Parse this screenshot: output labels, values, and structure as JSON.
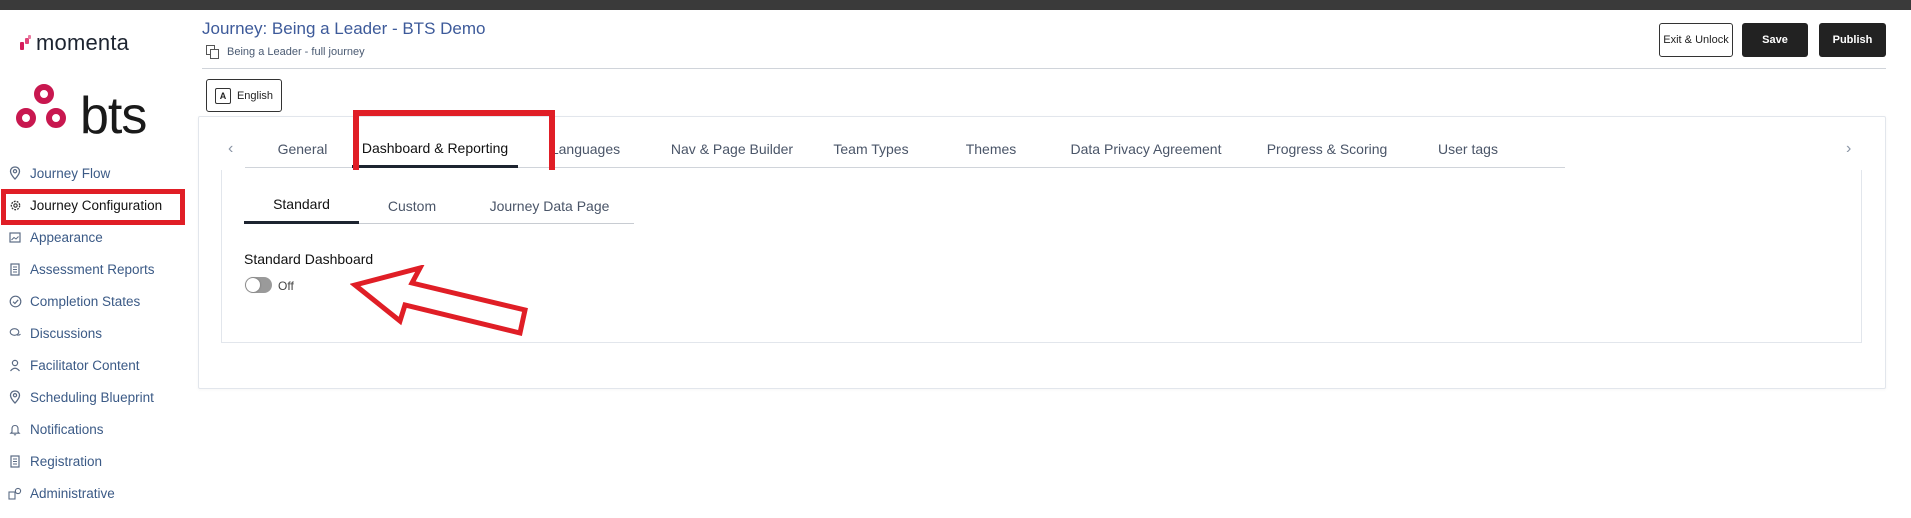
{
  "brand": {
    "top_logo": "momenta",
    "client_logo": "bts",
    "accent": "#d61c5b",
    "client_accent": "#c8174f"
  },
  "sidebar": {
    "items": [
      {
        "label": "Journey Flow",
        "icon": "map-pin-icon"
      },
      {
        "label": "Journey Configuration",
        "icon": "gear-icon",
        "active": true
      },
      {
        "label": "Appearance",
        "icon": "image-icon"
      },
      {
        "label": "Assessment Reports",
        "icon": "document-icon"
      },
      {
        "label": "Completion States",
        "icon": "check-circle-icon"
      },
      {
        "label": "Discussions",
        "icon": "chat-icon"
      },
      {
        "label": "Facilitator Content",
        "icon": "user-icon"
      },
      {
        "label": "Scheduling Blueprint",
        "icon": "map-pin-icon"
      },
      {
        "label": "Notifications",
        "icon": "bell-icon"
      },
      {
        "label": "Registration",
        "icon": "document-icon"
      },
      {
        "label": "Administrative",
        "icon": "admin-icon"
      }
    ]
  },
  "header": {
    "title": "Journey: Being a Leader - BTS Demo",
    "subtitle": "Being a Leader - full journey",
    "exit_label": "Exit & Unlock",
    "save_label": "Save",
    "publish_label": "Publish",
    "language_label": "English"
  },
  "tabs": [
    {
      "label": "General"
    },
    {
      "label": "Dashboard & Reporting",
      "active": true
    },
    {
      "label": "Languages"
    },
    {
      "label": "Nav & Page Builder"
    },
    {
      "label": "Team Types"
    },
    {
      "label": "Themes"
    },
    {
      "label": "Data Privacy Agreement"
    },
    {
      "label": "Progress & Scoring"
    },
    {
      "label": "User tags"
    }
  ],
  "subtabs": [
    {
      "label": "Standard",
      "active": true
    },
    {
      "label": "Custom"
    },
    {
      "label": "Journey Data Page"
    }
  ],
  "standard_dashboard": {
    "label": "Standard Dashboard",
    "toggle_state": "Off",
    "enabled": false
  },
  "annotation_color": "#e01e26"
}
